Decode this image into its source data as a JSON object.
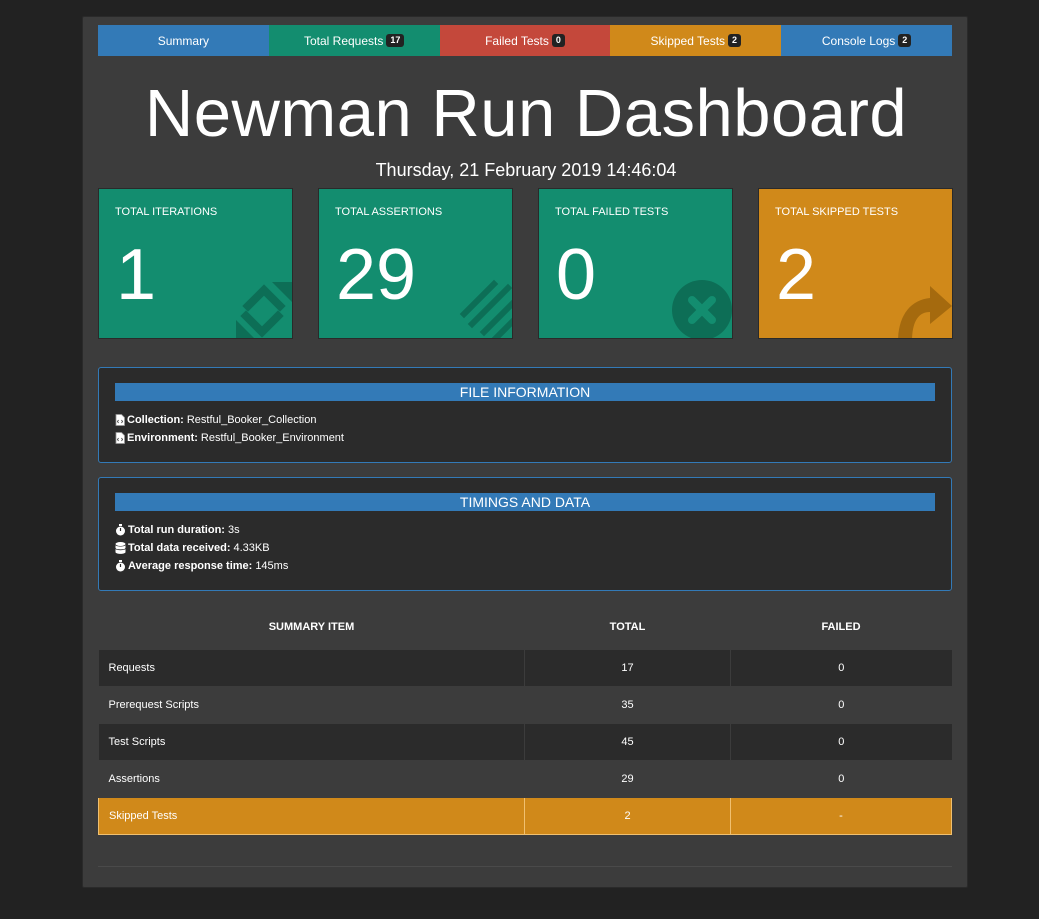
{
  "tabs": [
    {
      "label": "Summary",
      "badge": null,
      "color": "#337ab7"
    },
    {
      "label": "Total Requests",
      "badge": "17",
      "color": "#138d6f"
    },
    {
      "label": "Failed Tests",
      "badge": "0",
      "color": "#c4483b"
    },
    {
      "label": "Skipped Tests",
      "badge": "2",
      "color": "#d0891a"
    },
    {
      "label": "Console Logs",
      "badge": "2",
      "color": "#337ab7"
    }
  ],
  "header": {
    "title": "Newman Run Dashboard",
    "date": "Thursday, 21 February 2019 14:46:04"
  },
  "cards": [
    {
      "label": "TOTAL ITERATIONS",
      "value": "1",
      "icon": "sync-icon",
      "color": "#138d6f"
    },
    {
      "label": "TOTAL ASSERTIONS",
      "value": "29",
      "icon": "tasks-icon",
      "color": "#138d6f"
    },
    {
      "label": "TOTAL FAILED TESTS",
      "value": "0",
      "icon": "times-circle-icon",
      "color": "#138d6f"
    },
    {
      "label": "TOTAL SKIPPED TESTS",
      "value": "2",
      "icon": "share-arrow-icon",
      "color": "#d0891a"
    }
  ],
  "file_info": {
    "heading": "FILE INFORMATION",
    "collection_label": "Collection:",
    "collection_value": "Restful_Booker_Collection",
    "environment_label": "Environment:",
    "environment_value": "Restful_Booker_Environment"
  },
  "timings": {
    "heading": "TIMINGS AND DATA",
    "duration_label": "Total run duration:",
    "duration_value": "3s",
    "data_label": "Total data received:",
    "data_value": "4.33KB",
    "response_label": "Average response time:",
    "response_value": "145ms"
  },
  "summary_table": {
    "headers": [
      "SUMMARY ITEM",
      "TOTAL",
      "FAILED"
    ],
    "rows": [
      {
        "item": "Requests",
        "total": "17",
        "failed": "0"
      },
      {
        "item": "Prerequest Scripts",
        "total": "35",
        "failed": "0"
      },
      {
        "item": "Test Scripts",
        "total": "45",
        "failed": "0"
      },
      {
        "item": "Assertions",
        "total": "29",
        "failed": "0"
      },
      {
        "item": "Skipped Tests",
        "total": "2",
        "failed": "-"
      }
    ]
  }
}
